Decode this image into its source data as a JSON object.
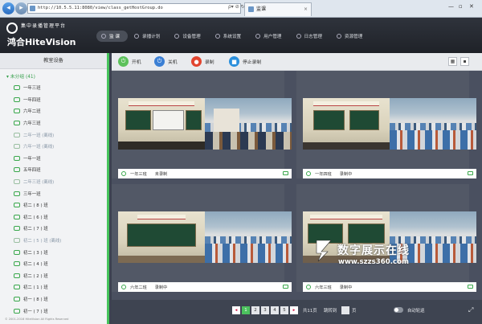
{
  "browser": {
    "url": "http://10.5.5.11:8080/view/class_getHostGroup.do",
    "url_tools": "ρ▾ ⊘ ↻",
    "tab_title": "监课",
    "tab_close": "×"
  },
  "header": {
    "logo_top": "集中录播管理平台",
    "logo_main": "鸿合HiteVision",
    "nav": [
      {
        "label": "监 课",
        "active": true
      },
      {
        "label": "录播计划"
      },
      {
        "label": "设备管理"
      },
      {
        "label": "系统设置"
      },
      {
        "label": "用户管理"
      },
      {
        "label": "日志管理"
      },
      {
        "label": "资源管理"
      }
    ]
  },
  "sidebar": {
    "title": "教室设备",
    "root": "▾ 未分组 (41)",
    "items": [
      {
        "label": "一年三班"
      },
      {
        "label": "一年四班"
      },
      {
        "label": "六年二班"
      },
      {
        "label": "六年三班"
      },
      {
        "label": "二年一班 (离线)",
        "offline": true
      },
      {
        "label": "六年一班 (离线)",
        "offline": true
      },
      {
        "label": "一年一班"
      },
      {
        "label": "五年四班"
      },
      {
        "label": "二年三班 (离线)",
        "offline": true
      },
      {
        "label": "三年一班"
      },
      {
        "label": "初二 ( 8 ) 班"
      },
      {
        "label": "初二 ( 6 ) 班"
      },
      {
        "label": "初二 ( 7 ) 班"
      },
      {
        "label": "初二 ( 5 ) 班 (离线)",
        "offline": true
      },
      {
        "label": "初二 ( 3 ) 班"
      },
      {
        "label": "初二 ( 4 ) 班"
      },
      {
        "label": "初二 ( 2 ) 班"
      },
      {
        "label": "初二 ( 1 ) 班"
      },
      {
        "label": "初一 ( 8 ) 班"
      },
      {
        "label": "初一 ( 7 ) 班"
      }
    ],
    "copyright": "© 2001-2016 HiteVision All Rights Reserved"
  },
  "toolbar": {
    "buttons": [
      {
        "label": "开机",
        "color": "#5cc15a",
        "glyph": "⏻"
      },
      {
        "label": "关机",
        "color": "#3b7fd4",
        "glyph": "⏻"
      },
      {
        "label": "录制",
        "color": "#e2452f",
        "glyph": "●"
      },
      {
        "label": "停止录制",
        "color": "#2a8fdc",
        "glyph": "■"
      }
    ],
    "view_grid": "▦",
    "view_single": "▪"
  },
  "cells": [
    {
      "room": "一年三班",
      "status": "未录制"
    },
    {
      "room": "一年四班",
      "status": "录制中"
    },
    {
      "room": "六年二班",
      "status": "录制中"
    },
    {
      "room": "六年三班",
      "status": "录制中"
    }
  ],
  "watermark": {
    "text": "数字展示在线",
    "url": "www.szzs360.com"
  },
  "pager": {
    "prev": "◂",
    "pages": [
      "1",
      "2",
      "3",
      "4",
      "5"
    ],
    "current": "1",
    "next": "▸",
    "total": "共11页",
    "jump_label": "跳转到",
    "page_unit": "页",
    "auto_rotate": "自动轮巡",
    "fullscreen": "⤢"
  }
}
